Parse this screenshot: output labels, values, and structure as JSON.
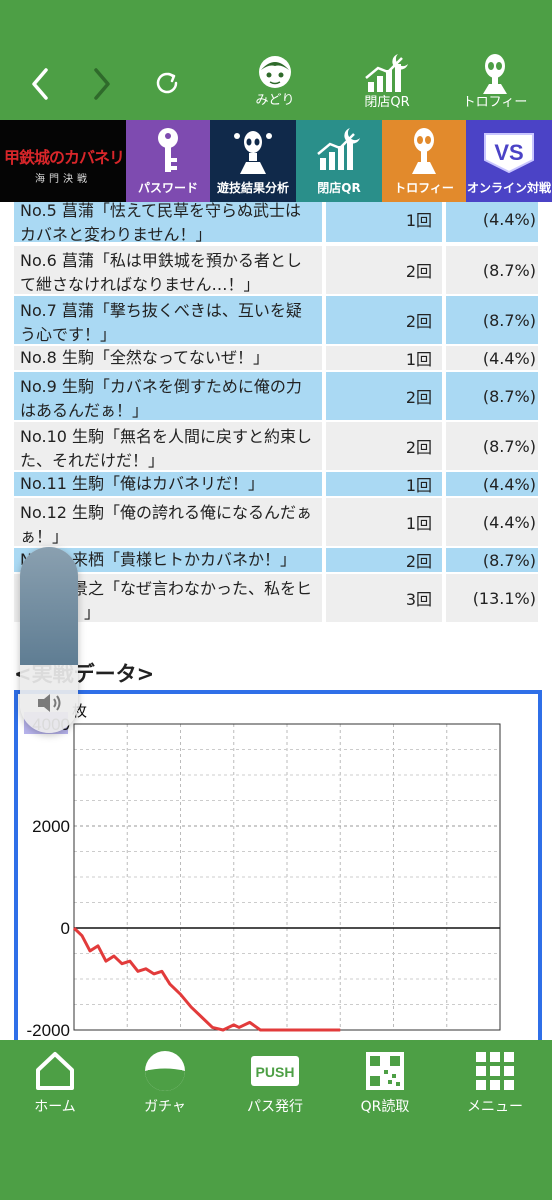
{
  "topbar": {
    "icons": [
      {
        "icon": "midori-character-icon",
        "label": "みどり"
      },
      {
        "icon": "closing-qr-chart-icon",
        "label": "閉店QR"
      },
      {
        "icon": "trophy-alien-icon",
        "label": "トロフィー"
      }
    ]
  },
  "menu": {
    "game_logo": {
      "line1": "甲鉄城のカバネリ",
      "line2": "海門決戦"
    },
    "tiles": [
      {
        "label": "パスワード",
        "color": "#7e4bb0",
        "icon": "key-icon"
      },
      {
        "label": "遊技結果分析",
        "color": "#10294a",
        "icon": "analysis-alien-icon"
      },
      {
        "label": "閉店QR",
        "color": "#2a8f8a",
        "icon": "closing-qr-chart-icon"
      },
      {
        "label": "トロフィー",
        "color": "#e28a2c",
        "icon": "trophy-alien-icon"
      },
      {
        "label": "オンライン対戦",
        "color": "#4b43c6",
        "icon": "vs-online-icon"
      }
    ]
  },
  "quotes": [
    {
      "text": "No.5 菖蒲「怯えて民草を守らぬ武士はカバネと変わりません！」",
      "count": "1回",
      "pct": "(4.4%)",
      "style": "blue"
    },
    {
      "text": "No.6 菖蒲「私は甲鉄城を預かる者として紲さなければなりません…！」",
      "count": "2回",
      "pct": "(8.7%)",
      "style": "gray"
    },
    {
      "text": "No.7 菖蒲「撃ち抜くべきは、互いを疑う心です！」",
      "count": "2回",
      "pct": "(8.7%)",
      "style": "blue"
    },
    {
      "text": "No.8 生駒「全然なってないぜ！」",
      "count": "1回",
      "pct": "(4.4%)",
      "style": "gray"
    },
    {
      "text": "No.9 生駒「カバネを倒すために俺の力はあるんだぁ！」",
      "count": "2回",
      "pct": "(8.7%)",
      "style": "blue"
    },
    {
      "text": "No.10 生駒「無名を人間に戻すと約束した、それだけだ！」",
      "count": "2回",
      "pct": "(8.7%)",
      "style": "gray"
    },
    {
      "text": "No.11 生駒「俺はカバネリだ！」",
      "count": "1回",
      "pct": "(4.4%)",
      "style": "blue"
    },
    {
      "text": "No.12 生駒「俺の誇れる俺になるんだぁぁ！」",
      "count": "1回",
      "pct": "(4.4%)",
      "style": "gray"
    },
    {
      "text": "No.14 来栖「貴様ヒトかカバネか！」",
      "count": "2回",
      "pct": "(8.7%)",
      "style": "blue"
    },
    {
      "text": "No.17 景之「なぜ言わなかった、私をヒトだと！」",
      "count": "3回",
      "pct": "(13.1%)",
      "style": "gray"
    }
  ],
  "section_title": "<実戦データ>",
  "chart_data": {
    "type": "line",
    "unit_label": "枚",
    "y_ticks": [
      4000,
      2000,
      0,
      -2000
    ],
    "ylim": [
      -2000,
      4000
    ],
    "xlim": [
      0,
      8
    ],
    "x": [
      0,
      0.15,
      0.3,
      0.45,
      0.6,
      0.75,
      0.9,
      1.05,
      1.2,
      1.35,
      1.5,
      1.65,
      1.8,
      2.0,
      2.2,
      2.4,
      2.6,
      2.8,
      3.0,
      3.1,
      3.3,
      3.5,
      4.0,
      5.0
    ],
    "y": [
      0,
      -150,
      -450,
      -350,
      -650,
      -550,
      -700,
      -650,
      -850,
      -800,
      -900,
      -850,
      -1100,
      -1300,
      -1550,
      -1750,
      -1950,
      -2000,
      -1900,
      -1950,
      -1850,
      -2000,
      -2000,
      -2000
    ],
    "line_color": "#e23b3b",
    "grid": true
  },
  "bottom_nav": [
    {
      "label": "ホーム",
      "icon": "home-icon"
    },
    {
      "label": "ガチャ",
      "icon": "gacha-ball-icon"
    },
    {
      "label": "パス発行",
      "icon": "push-pass-icon"
    },
    {
      "label": "QR読取",
      "icon": "qr-code-icon"
    },
    {
      "label": "メニュー",
      "icon": "menu-grid-icon"
    }
  ]
}
